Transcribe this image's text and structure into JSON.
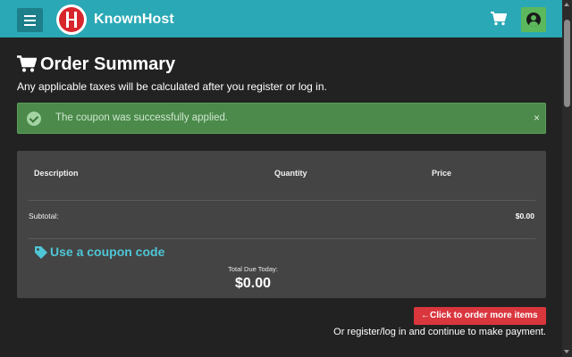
{
  "header": {
    "brand": "KnownHost",
    "brand_color": "#2aa8b5",
    "icons": [
      "menu-icon",
      "knownhost-logo",
      "cart-icon",
      "user-icon"
    ]
  },
  "page": {
    "title": "Order Summary",
    "subtitle": "Any applicable taxes will be calculated after you register or log in."
  },
  "alert": {
    "message": "The coupon was successfully applied.",
    "close": "×",
    "color": "#4b8a4b"
  },
  "summary": {
    "columns": {
      "description": "Description",
      "quantity": "Quantity",
      "price": "Price"
    },
    "subtotal_label": "Subtotal:",
    "subtotal_value": "$0.00",
    "coupon_link": "Use a coupon code",
    "total_label": "Total Due Today:",
    "total_value": "$0.00"
  },
  "actions": {
    "order_more_arrow": "←",
    "order_more": "Click to order more items",
    "order_more_color": "#d9363e",
    "footer_note": "Or register/log in and continue to make payment."
  }
}
